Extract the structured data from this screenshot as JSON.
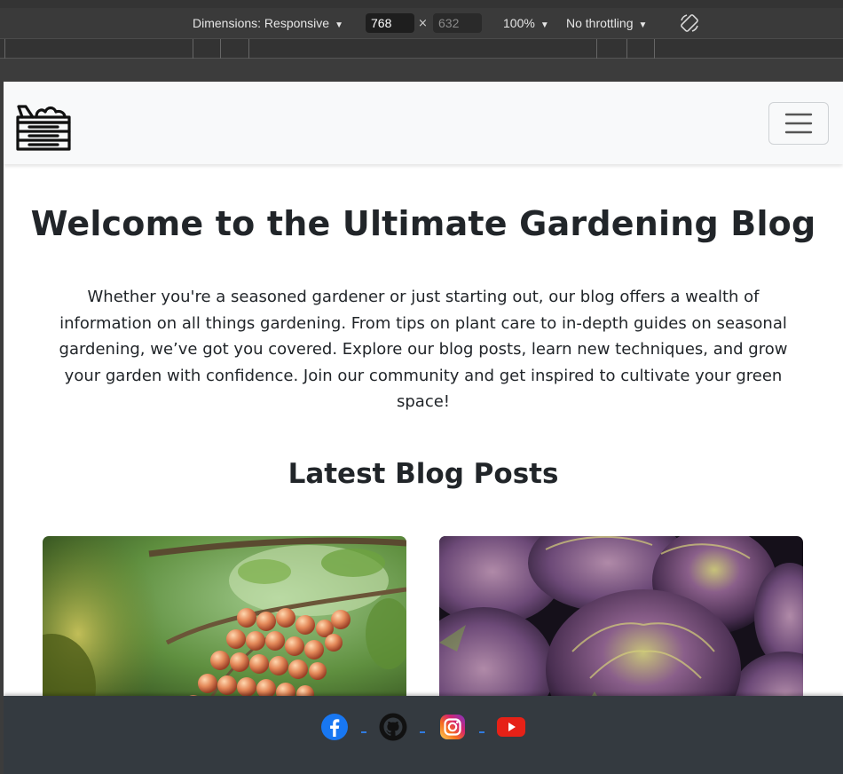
{
  "devtools": {
    "dimensions_label": "Dimensions: Responsive",
    "width": "768",
    "height": "632",
    "zoom": "100%",
    "throttling": "No throttling"
  },
  "navbar": {
    "brand_icon": "garden-crate-icon",
    "toggler_icon": "hamburger-menu-icon"
  },
  "hero": {
    "title": "Welcome to the Ultimate Gardening Blog",
    "text": "Whether you're a seasoned gardener or just starting out, our blog offers a wealth of information on all things gardening. From tips on plant care to in-depth guides on seasonal gardening, we’ve got you covered. Explore our blog posts, learn new techniques, and grow your garden with confidence. Join our community and get inspired to cultivate your green space!"
  },
  "posts": {
    "title": "Latest Blog Posts",
    "cards": [
      {
        "image": "grapes-on-vine-photo"
      },
      {
        "image": "artichokes-photo"
      }
    ]
  },
  "footer": {
    "social": [
      {
        "icon": "facebook-icon",
        "color": "#1877f2"
      },
      {
        "icon": "github-icon",
        "color": "#111111"
      },
      {
        "icon": "instagram-icon",
        "color": "#e1306c"
      },
      {
        "icon": "youtube-icon",
        "color": "#e62117"
      }
    ],
    "separator_color": "#2f7be0"
  },
  "colors": {
    "navbar_bg": "#f8f9fa",
    "footer_bg": "#343a40",
    "text": "#212529"
  }
}
